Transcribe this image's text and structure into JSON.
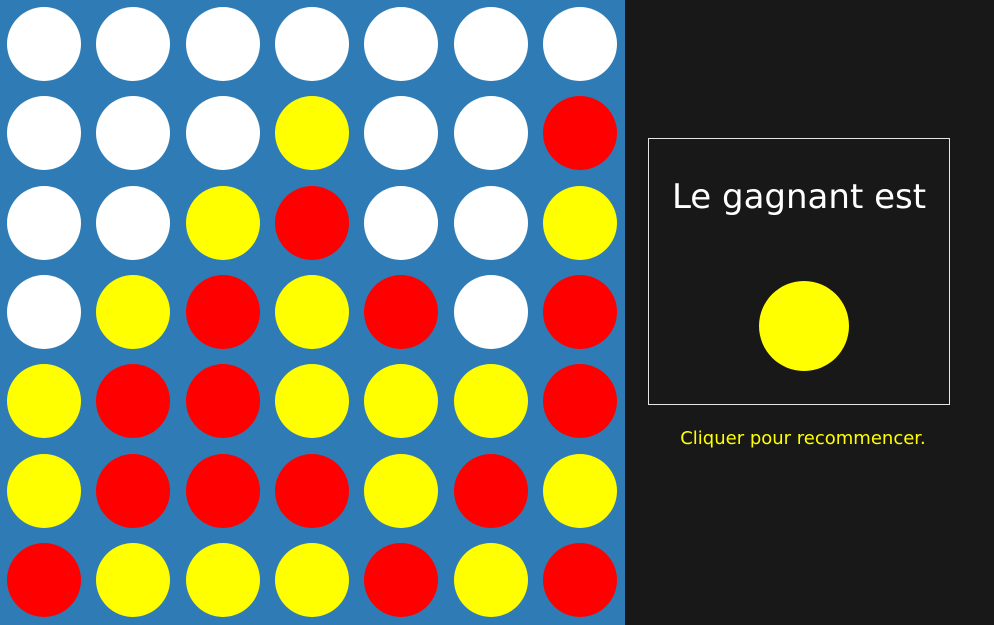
{
  "colors": {
    "board": "#2e7bb5",
    "empty": "#ffffff",
    "red": "#ff0000",
    "yellow": "#ffff00",
    "panel": "#181818",
    "restart_text": "#ffff00"
  },
  "board": {
    "columns": 7,
    "rows": 7,
    "cells": [
      [
        "empty",
        "empty",
        "empty",
        "empty",
        "empty",
        "empty",
        "empty"
      ],
      [
        "empty",
        "empty",
        "empty",
        "yellow",
        "empty",
        "empty",
        "red"
      ],
      [
        "empty",
        "empty",
        "yellow",
        "red",
        "empty",
        "empty",
        "yellow"
      ],
      [
        "empty",
        "yellow",
        "red",
        "yellow",
        "red",
        "empty",
        "red"
      ],
      [
        "yellow",
        "red",
        "red",
        "yellow",
        "yellow",
        "yellow",
        "red"
      ],
      [
        "yellow",
        "red",
        "red",
        "red",
        "yellow",
        "red",
        "yellow"
      ],
      [
        "red",
        "yellow",
        "yellow",
        "yellow",
        "red",
        "yellow",
        "red"
      ]
    ]
  },
  "panel": {
    "winner_label": "Le gagnant est",
    "winner_color": "yellow",
    "restart_label": "Cliquer pour recommencer."
  }
}
